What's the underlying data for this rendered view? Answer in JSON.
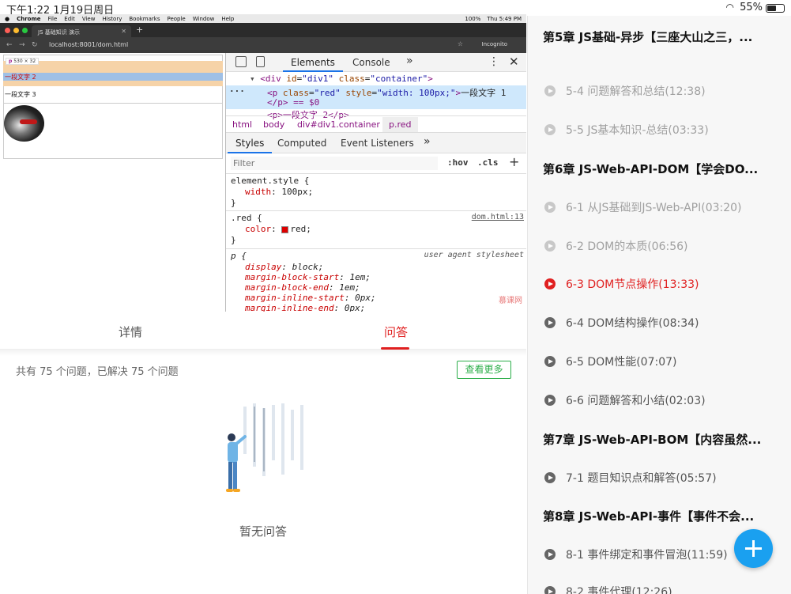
{
  "status_bar": {
    "time": "下午1:22  1月19日周日",
    "battery": "55%"
  },
  "mac": {
    "menubar": [
      "Chrome",
      "File",
      "Edit",
      "View",
      "History",
      "Bookmarks",
      "People",
      "Window",
      "Help"
    ],
    "battery": "100%",
    "clock": "Thu 5:49 PM"
  },
  "browser": {
    "tab_title": "JS 基础知识 演示",
    "url": "localhost:8001/dom.html",
    "incognito": "Incognito"
  },
  "page": {
    "hover_tag": "p",
    "hover_size": "530 × 32",
    "para2": "一段文字 2",
    "para3": "一段文字 3"
  },
  "devtools": {
    "tabs": {
      "elements": "Elements",
      "console": "Console",
      "more": "»"
    },
    "dom": {
      "line1_tag": "<div",
      "line1_id_attr": "id",
      "line1_id_val": "\"div1\"",
      "line1_class_attr": "class",
      "line1_class_val": "\"container\"",
      "line1_end": ">",
      "line2_open": "<p",
      "line2_class_val": "\"red\"",
      "line2_style_attr": "style",
      "line2_style_val": "\"width: 100px;\"",
      "line2_text": "一段文字 1",
      "line3": "</p> == $0",
      "line4": "<p>一段文字 2</p>"
    },
    "breadcrumbs": [
      "html",
      "body",
      "div#div1.container",
      "p.red"
    ],
    "style_tabs": [
      "Styles",
      "Computed",
      "Event Listeners"
    ],
    "filter_placeholder": "Filter",
    "hov": ":hov",
    "cls": ".cls",
    "rules": {
      "element_style": "element.style {",
      "width_prop": "width",
      "width_val": "100px;",
      "red_sel": ".red {",
      "red_src": "dom.html:13",
      "color_prop": "color",
      "color_val": "red;",
      "ua_sel": "p {",
      "ua_src": "user agent stylesheet",
      "ua_props": [
        {
          "name": "display",
          "value": "block;"
        },
        {
          "name": "margin-block-start",
          "value": "1em;"
        },
        {
          "name": "margin-block-end",
          "value": "1em;"
        },
        {
          "name": "margin-inline-start",
          "value": "0px;"
        },
        {
          "name": "margin-inline-end",
          "value": "0px;"
        }
      ],
      "close": "}"
    },
    "watermark": "慕课网"
  },
  "detail_tabs": {
    "detail": "详情",
    "qa": "问答"
  },
  "qa": {
    "summary": "共有 75 个问题，已解决 75 个问题",
    "more_button": "查看更多",
    "empty": "暂无问答"
  },
  "sidebar": {
    "chapter5": "第5章 JS基础-异步【三座大山之三，...",
    "s5_4": "5-4 问题解答和总结(12:38)",
    "s5_5": "5-5 JS基本知识-总结(03:33)",
    "chapter6": "第6章 JS-Web-API-DOM【学会DO...",
    "s6_1": "6-1 从JS基础到JS-Web-API(03:20)",
    "s6_2": "6-2 DOM的本质(06:56)",
    "s6_3": "6-3 DOM节点操作(13:33)",
    "s6_4": "6-4 DOM结构操作(08:34)",
    "s6_5": "6-5 DOM性能(07:07)",
    "s6_6": "6-6 问题解答和小结(02:03)",
    "chapter7": "第7章 JS-Web-API-BOM【内容虽然...",
    "s7_1": "7-1 题目知识点和解答(05:57)",
    "chapter8": "第8章 JS-Web-API-事件【事件不会...",
    "s8_1": "8-1 事件绑定和事件冒泡(11:59)",
    "s8_2": "8-2 事件代理(12:26)"
  },
  "colors": {
    "accent_red": "#e02020",
    "green": "#2cae4a",
    "fab_blue": "#1aa0f0"
  }
}
